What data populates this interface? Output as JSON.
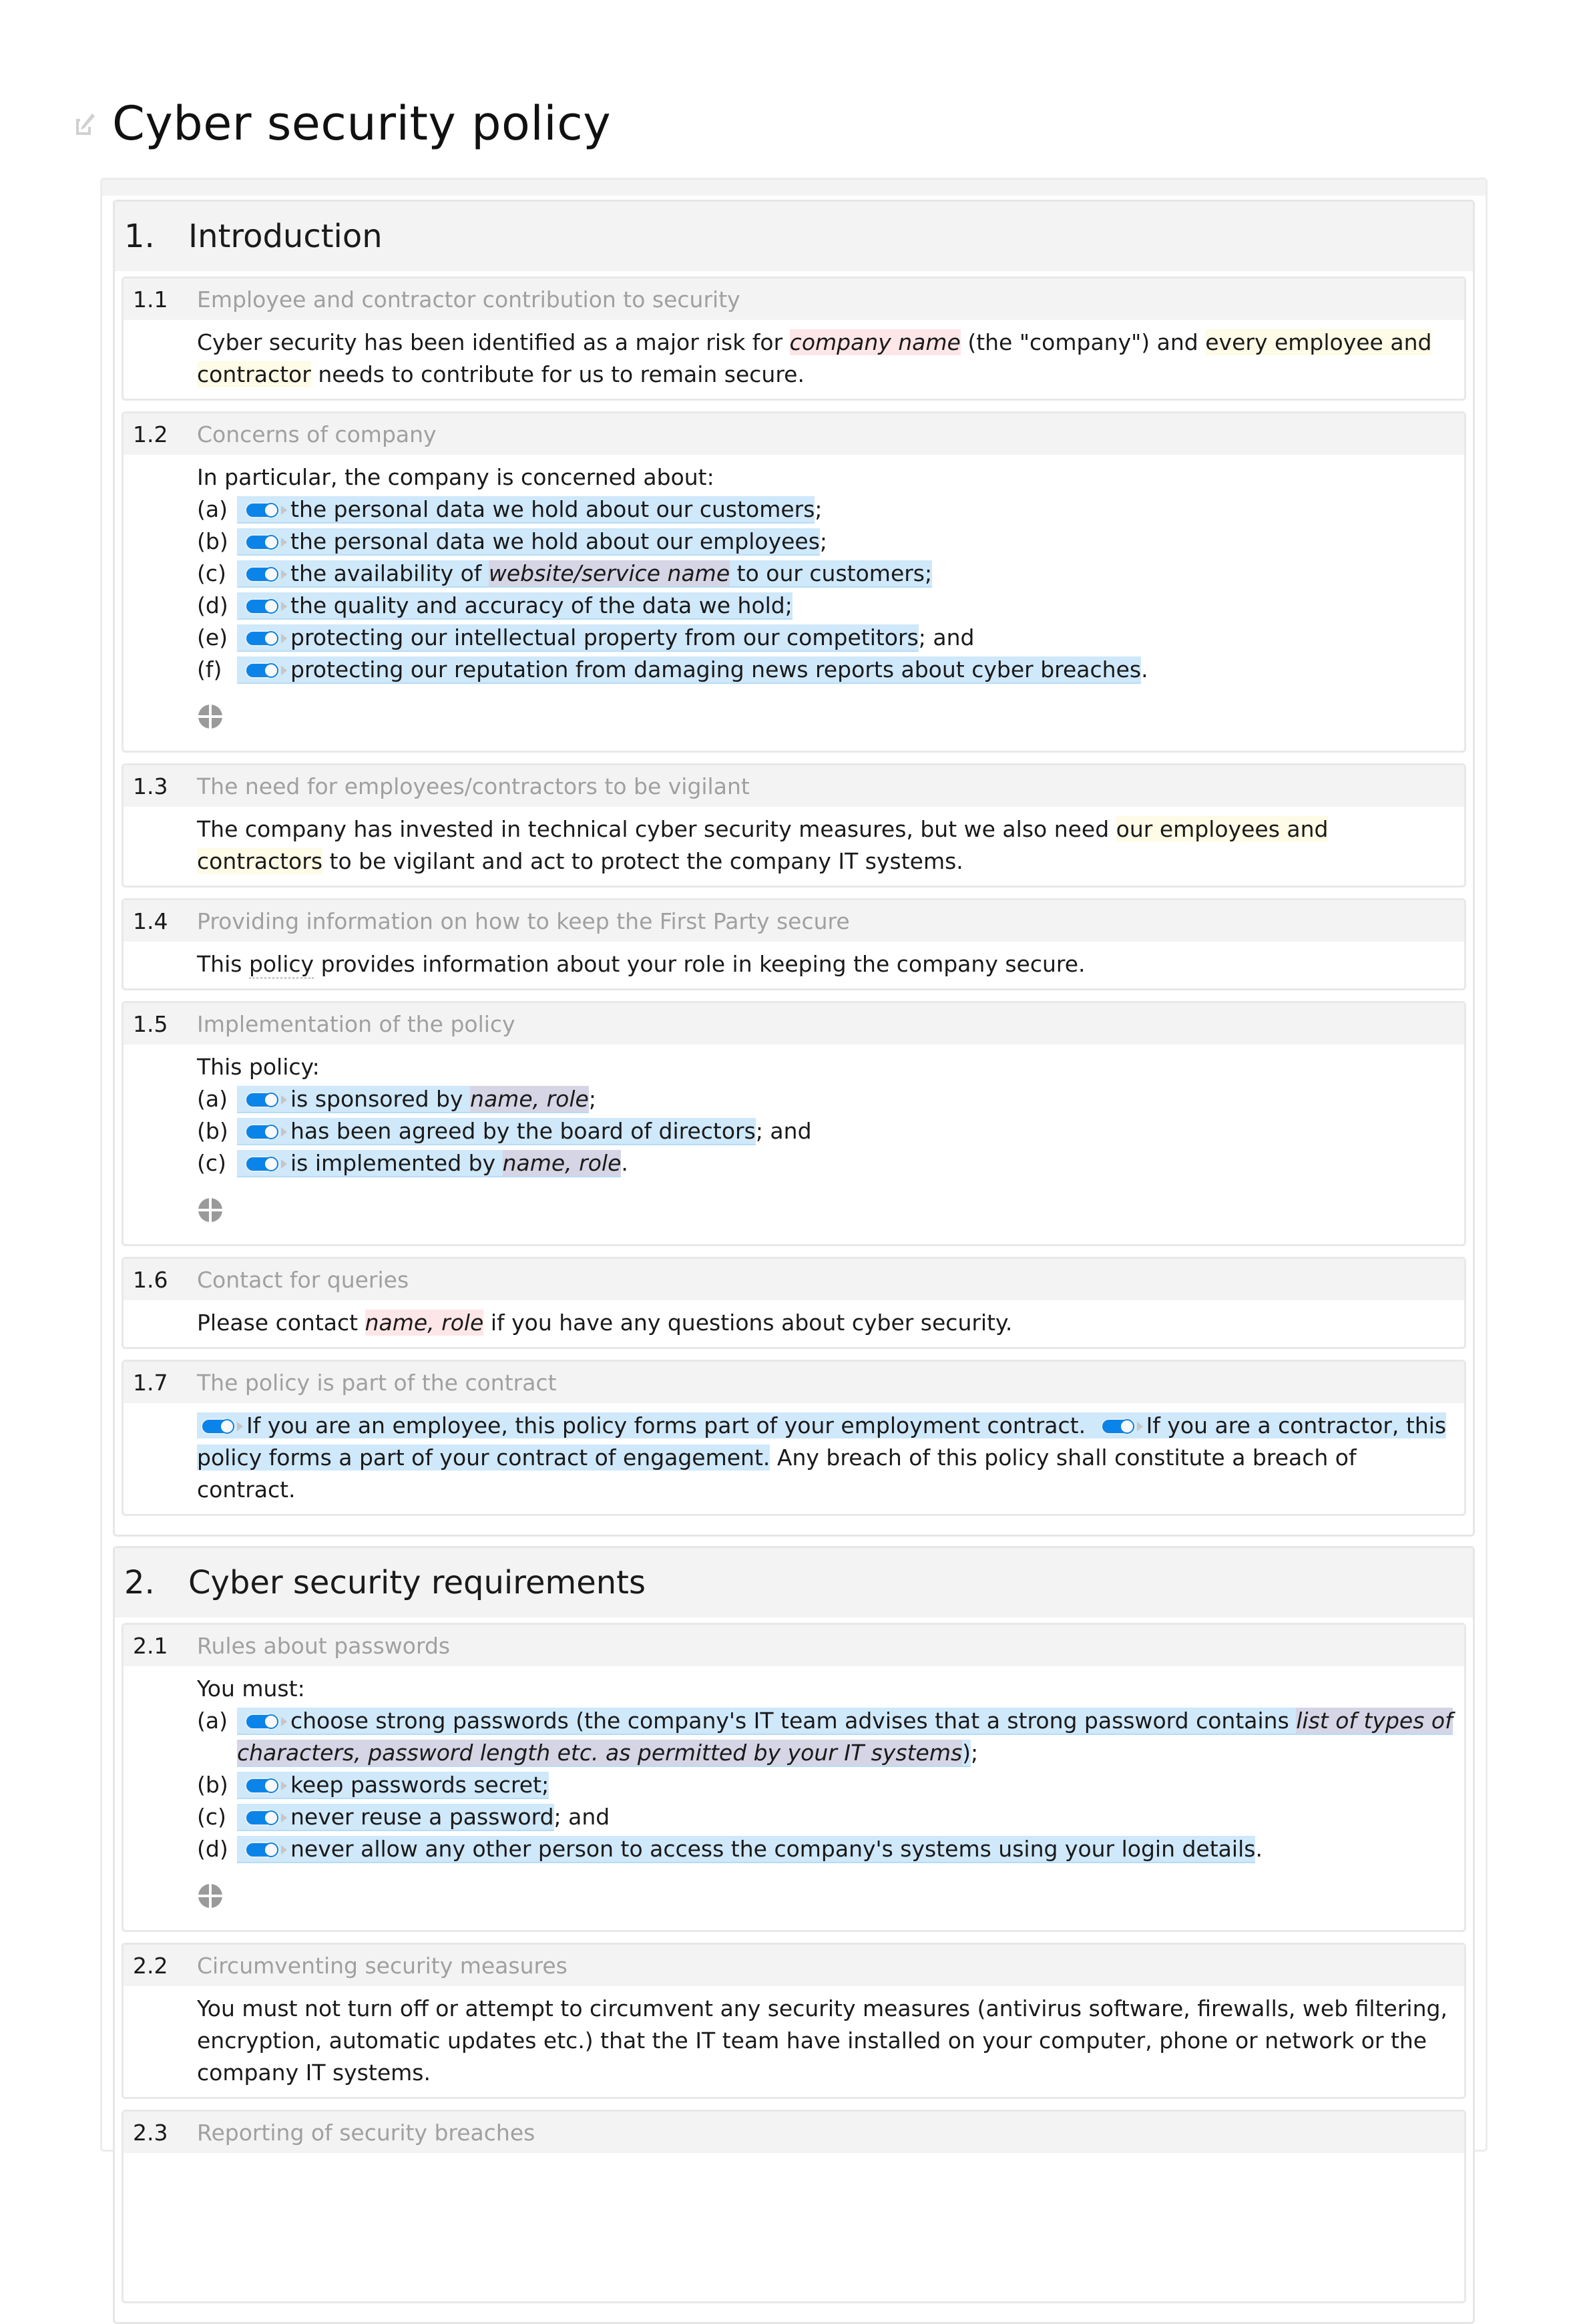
{
  "document": {
    "title": "Cyber security policy",
    "title_icon": "edit-icon"
  },
  "colors": {
    "placeholder_red": "#fde6e8",
    "highlight_yellow": "#fefbe6",
    "optional_blue": "#cfe8fa",
    "variable_purple": "#d5d5e5",
    "toggle_on": "#0a84e8",
    "section_header_bg": "#f3f3f3",
    "subheading_text": "#a0a0a0"
  },
  "sections": [
    {
      "number": "1.",
      "title": "Introduction",
      "subsections": [
        {
          "number": "1.1",
          "title": "Employee and contractor contribution to security",
          "text_before": "Cyber security has been identified as a major risk for ",
          "placeholder": "company name",
          "text_middle": " (the \"company\") and ",
          "highlight": "every employee and contractor",
          "text_after": " needs to contribute for us to remain secure."
        },
        {
          "number": "1.2",
          "title": "Concerns of company",
          "intro": "In particular, the company is concerned about:",
          "items": [
            {
              "letter": "(a)",
              "text": "the personal data we hold about our customers",
              "suffix": ";"
            },
            {
              "letter": "(b)",
              "text": "the personal data we hold about our employees",
              "suffix": ";"
            },
            {
              "letter": "(c)",
              "text_before": "the availability of ",
              "variable": "website/service name",
              "text_after": " to our customers",
              "suffix": ";"
            },
            {
              "letter": "(d)",
              "text": "the quality and accuracy of the data we hold",
              "suffix": ";"
            },
            {
              "letter": "(e)",
              "text": "protecting our intellectual property from our competitors",
              "suffix": "; and"
            },
            {
              "letter": "(f)",
              "text": "protecting our reputation from damaging news reports about cyber breaches",
              "suffix": "."
            }
          ],
          "add_icon": "add-circle-icon"
        },
        {
          "number": "1.3",
          "title": "The need for employees/contractors to be vigilant",
          "text_before": "The company has invested in technical cyber security measures, but we also need ",
          "highlight": "our employees and contractors",
          "text_after": " to be vigilant and act to protect the company IT systems."
        },
        {
          "number": "1.4",
          "title": "Providing information on how to keep the First Party secure",
          "text_before": "This ",
          "underlined": "policy",
          "text_after": " provides information about your role in keeping the company secure."
        },
        {
          "number": "1.5",
          "title": "Implementation of the policy",
          "intro": "This policy:",
          "items": [
            {
              "letter": "(a)",
              "text_before": "is sponsored by ",
              "variable": "name, role",
              "suffix": ";"
            },
            {
              "letter": "(b)",
              "text": "has been agreed by the board of directors",
              "suffix": "; and"
            },
            {
              "letter": "(c)",
              "text_before": "is implemented by ",
              "variable": "name, role",
              "suffix": "."
            }
          ],
          "add_icon": "add-circle-icon"
        },
        {
          "number": "1.6",
          "title": "Contact for queries",
          "text_before": "Please contact ",
          "placeholder": "name, role",
          "text_after": " if you have any questions about cyber security."
        },
        {
          "number": "1.7",
          "title": "The policy is part of the contract",
          "option_employee": "If you are an employee, this policy forms part of your employment contract.",
          "option_contractor_line1": "If you are a contractor,",
          "option_contractor_line2": "this policy forms a part of your contract of engagement.",
          "text_after": " Any breach of this policy shall constitute a breach of contract."
        }
      ]
    },
    {
      "number": "2.",
      "title": "Cyber security requirements",
      "subsections": [
        {
          "number": "2.1",
          "title": "Rules about passwords",
          "intro": "You must:",
          "items": [
            {
              "letter": "(a)",
              "text_before": "choose strong passwords (the company's IT team advises that a strong password contains ",
              "variable": "list of types of characters, password length etc. as permitted by your IT systems",
              "text_after": ")",
              "suffix": ";"
            },
            {
              "letter": "(b)",
              "text": "keep passwords secret",
              "suffix": ";"
            },
            {
              "letter": "(c)",
              "text": "never reuse a password",
              "suffix": "; and"
            },
            {
              "letter": "(d)",
              "text": "never allow any other person to access the company's systems using your login details",
              "suffix": "."
            }
          ],
          "add_icon": "add-circle-icon"
        },
        {
          "number": "2.2",
          "title": "Circumventing security measures",
          "text": "You must not turn off or attempt to circumvent any security measures (antivirus software, firewalls, web filtering, encryption, automatic updates etc.) that the IT team have installed on your computer, phone or network or the company IT systems."
        },
        {
          "number": "2.3",
          "title": "Reporting of security breaches"
        }
      ]
    }
  ]
}
